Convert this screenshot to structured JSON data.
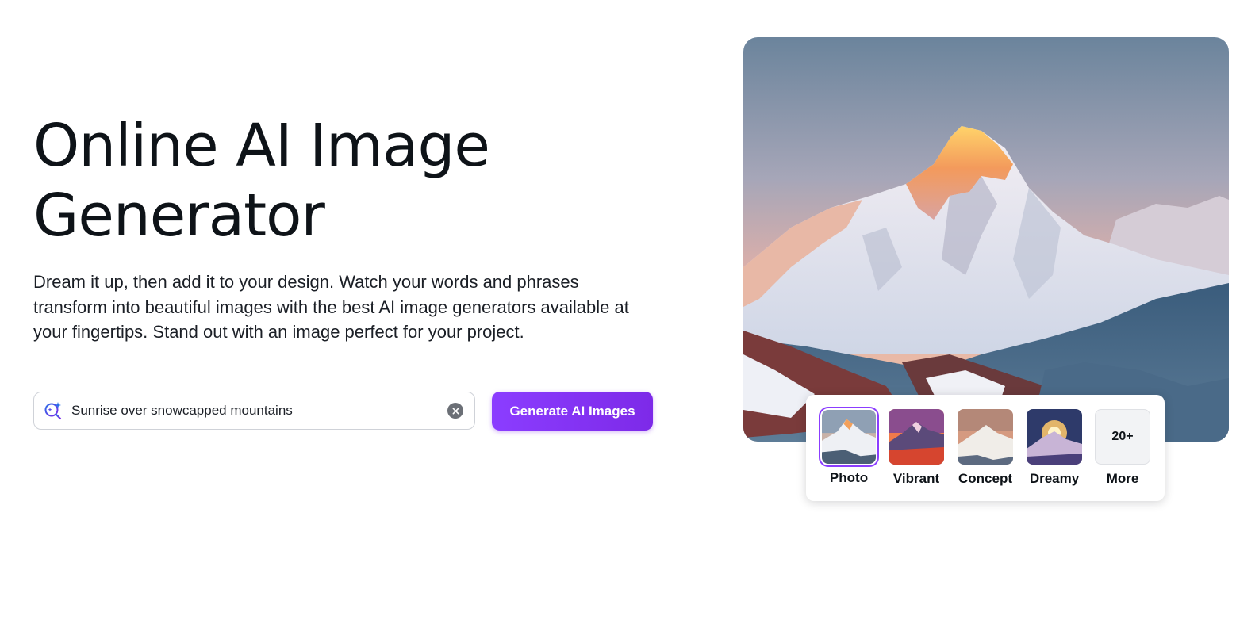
{
  "hero": {
    "title": "Online AI Image Generator",
    "description": "Dream it up, then add it to your design. Watch your words and phrases transform into beautiful images with the best AI image generators available at your fingertips. Stand out with an image perfect for your project."
  },
  "search": {
    "value": "Sunrise over snowcapped mountains",
    "icon": "ai-search-icon",
    "clear_icon": "clear-icon"
  },
  "cta": {
    "label": "Generate AI Images"
  },
  "colors": {
    "accent": "#8b3dff",
    "text": "#0e1318"
  },
  "styles": {
    "selected": "Photo",
    "options": [
      {
        "label": "Photo"
      },
      {
        "label": "Vibrant"
      },
      {
        "label": "Concept"
      },
      {
        "label": "Dreamy"
      },
      {
        "label": "More",
        "badge": "20+"
      }
    ]
  }
}
